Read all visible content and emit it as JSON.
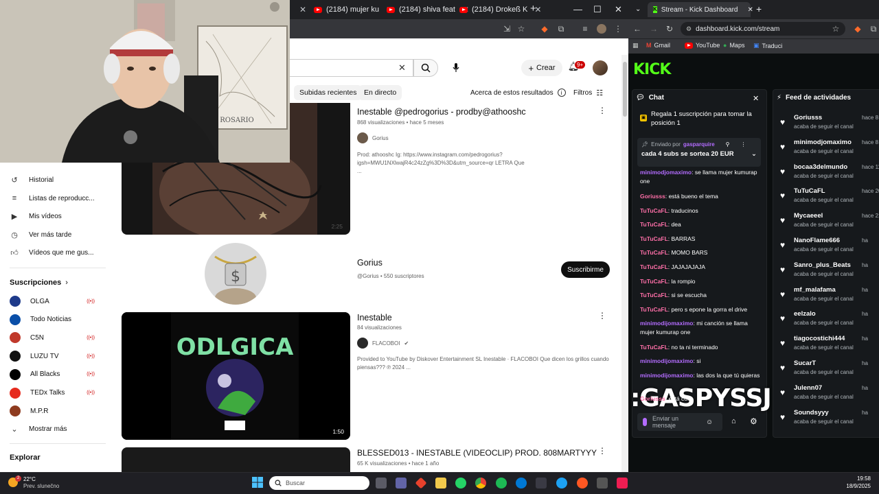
{
  "yt": {
    "tabs": [
      {
        "label": "(2184) mujer ku"
      },
      {
        "label": "(2184) shiva feat"
      },
      {
        "label": "(2184) Drokeß K"
      }
    ],
    "new_tab": "+",
    "search": {
      "clear": "✕"
    },
    "create_label": "Crear",
    "notif_count": "9+",
    "chips": [
      "Subidas recientes",
      "En directo"
    ],
    "about_results": "Acerca de estos resultados",
    "filters_label": "Filtros",
    "sidebar": {
      "items": [
        {
          "label": "Historial"
        },
        {
          "label": "Listas de reproducc..."
        },
        {
          "label": "Mis vídeos"
        },
        {
          "label": "Ver más tarde"
        },
        {
          "label": "Vídeos que me gus..."
        }
      ],
      "subs_heading": "Suscripciones",
      "subs": [
        {
          "label": "OLGA",
          "live": true,
          "color": "#1e3a8a"
        },
        {
          "label": "Todo Noticias",
          "live": false,
          "color": "#0a4fa8"
        },
        {
          "label": "C5N",
          "live": true,
          "color": "#c0392b"
        },
        {
          "label": "LUZU TV",
          "live": true,
          "color": "#111111"
        },
        {
          "label": "All Blacks",
          "live": true,
          "color": "#000000"
        },
        {
          "label": "TEDx Talks",
          "live": true,
          "color": "#e62b1e"
        },
        {
          "label": "M.P.R",
          "live": false,
          "color": "#8e3b1f"
        }
      ],
      "show_more": "Mostrar más",
      "explore": "Explorar"
    },
    "results": [
      {
        "title": "Inestable @pedrogorius - prodby@athooshc",
        "meta": "868 visualizaciones • hace 5 meses",
        "channel": "Gorius",
        "desc": "Prod: athooshc Ig: https://www.instagram.com/pedrogorius?igsh=MWU1NXlwajR4c24zZg%3D%3D&utm_source=qr LETRA Que ...",
        "duration": "2:25"
      },
      {
        "channel_title": "Gorius",
        "channel_meta": "@Gorius • 550 suscriptores",
        "subscribe": "Suscribirme"
      },
      {
        "title": "Inestable",
        "meta": "84 visualizaciones",
        "channel": "FLACOBOI",
        "desc": "Provided to YouTube by Diskover Entertainment SL Inestable · FLACOBOI Que dicen los grillos cuando piensas??? ℗ 2024 ...",
        "duration": "1:50",
        "art_text": "ODLGICA"
      },
      {
        "title": "BLESSED013 - INESTABLE (VIDEOCLIP) PROD. 808MARTYYY",
        "meta": "65 K visualizaciones • hace 1 año"
      }
    ]
  },
  "webcam": {
    "poster_text": "ROSARIO"
  },
  "kick": {
    "tab_title": "Stream - Kick Dashboard",
    "url": "dashboard.kick.com/stream",
    "bookmarks": [
      "Gmail",
      "YouTube",
      "Maps",
      "Traduci"
    ],
    "logo": "KICK",
    "chat": {
      "title": "Chat",
      "gift_banner": "Regala 1 suscripción para tomar la posición 1",
      "pinned_by_label": "Enviado por",
      "pinned_by_user": "gasparquire",
      "pinned_text": "cada 4 subs se sortea 20 EUR",
      "messages": [
        {
          "user": "minimodjomaximo",
          "text": ": se llama mujer kumurap one",
          "color": "purple"
        },
        {
          "user": "Goriusss",
          "text": ": está bueno el tema",
          "color": "pink"
        },
        {
          "user": "TuTuCaFL",
          "text": ": traducinos",
          "color": "pink"
        },
        {
          "user": "TuTuCaFL",
          "text": ": dea",
          "color": "pink"
        },
        {
          "user": "TuTuCaFL",
          "text": ": BARRAS",
          "color": "pink"
        },
        {
          "user": "TuTuCaFL",
          "text": ": MOMO BARS",
          "color": "pink"
        },
        {
          "user": "TuTuCaFL",
          "text": ": JAJAJAJAJA",
          "color": "pink"
        },
        {
          "user": "TuTuCaFL",
          "text": ": la rompio",
          "color": "pink"
        },
        {
          "user": "TuTuCaFL",
          "text": ": si se escucha",
          "color": "pink"
        },
        {
          "user": "TuTuCaFL",
          "text": ": pero s epone la gorra el drive",
          "color": "pink"
        },
        {
          "user": "minimodijomaximo",
          "text": ": mi canción se llama mujer kumurap one",
          "color": "purple"
        },
        {
          "user": "TuTuCaFL",
          "text": ": no ta ni terminado",
          "color": "pink"
        },
        {
          "user": "minimodijomaximo",
          "text": ": si",
          "color": "purple"
        },
        {
          "user": "minimodijomaximo",
          "text": ": las dos la que tú quieras",
          "color": "purple"
        },
        {
          "user": "Goriusss",
          "text": ": está con",
          "color": "pink"
        }
      ],
      "overlay_name": ":GASPYSSJ",
      "input_placeholder": "Enviar un mensaje"
    },
    "feed": {
      "title": "Feed de actividades",
      "sub_text": "acaba de seguir el canal",
      "items": [
        {
          "name": "Goriusss",
          "time": "hace 8"
        },
        {
          "name": "minimodjomaximo",
          "time": "hace 8"
        },
        {
          "name": "bocaa3delmundo",
          "time": "hace 11"
        },
        {
          "name": "TuTuCaFL",
          "time": "hace 20"
        },
        {
          "name": "Mycaeeel",
          "time": "hace 21"
        },
        {
          "name": "NanoFlame666",
          "time": "ha"
        },
        {
          "name": "Sanro_plus_Beats",
          "time": "ha"
        },
        {
          "name": "mf_malafama",
          "time": "ha"
        },
        {
          "name": "eelzalo",
          "time": "ha"
        },
        {
          "name": "tiagocostichi444",
          "time": "ha"
        },
        {
          "name": "SucarT",
          "time": "ha"
        },
        {
          "name": "Julenn07",
          "time": "ha"
        },
        {
          "name": "Soundsyyy",
          "time": "ha"
        }
      ]
    }
  },
  "taskbar": {
    "weather_temp": "22°C",
    "weather_desc": "Prev. slunečno",
    "search_placeholder": "Buscar",
    "time": "19:58",
    "date": "18/9/2025"
  }
}
